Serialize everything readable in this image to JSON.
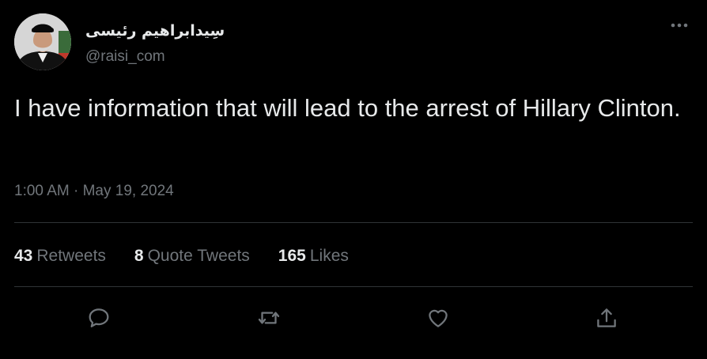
{
  "user": {
    "display_name": "سِیدابراهیم رئیسی",
    "handle": "@raisi_com"
  },
  "tweet": {
    "text": "I have information that will lead to the arrest of Hillary Clinton.",
    "time": "1:00 AM",
    "separator": "·",
    "date": "May 19, 2024"
  },
  "stats": {
    "retweets": {
      "count": "43",
      "label": "Retweets"
    },
    "quotes": {
      "count": "8",
      "label": "Quote Tweets"
    },
    "likes": {
      "count": "165",
      "label": "Likes"
    }
  },
  "actions": [
    "reply-icon",
    "retweet-icon",
    "like-icon",
    "share-icon"
  ],
  "colors": {
    "background": "#000000",
    "primary_text": "#e7e9ea",
    "secondary_text": "#71767b",
    "divider": "#2f3336"
  }
}
